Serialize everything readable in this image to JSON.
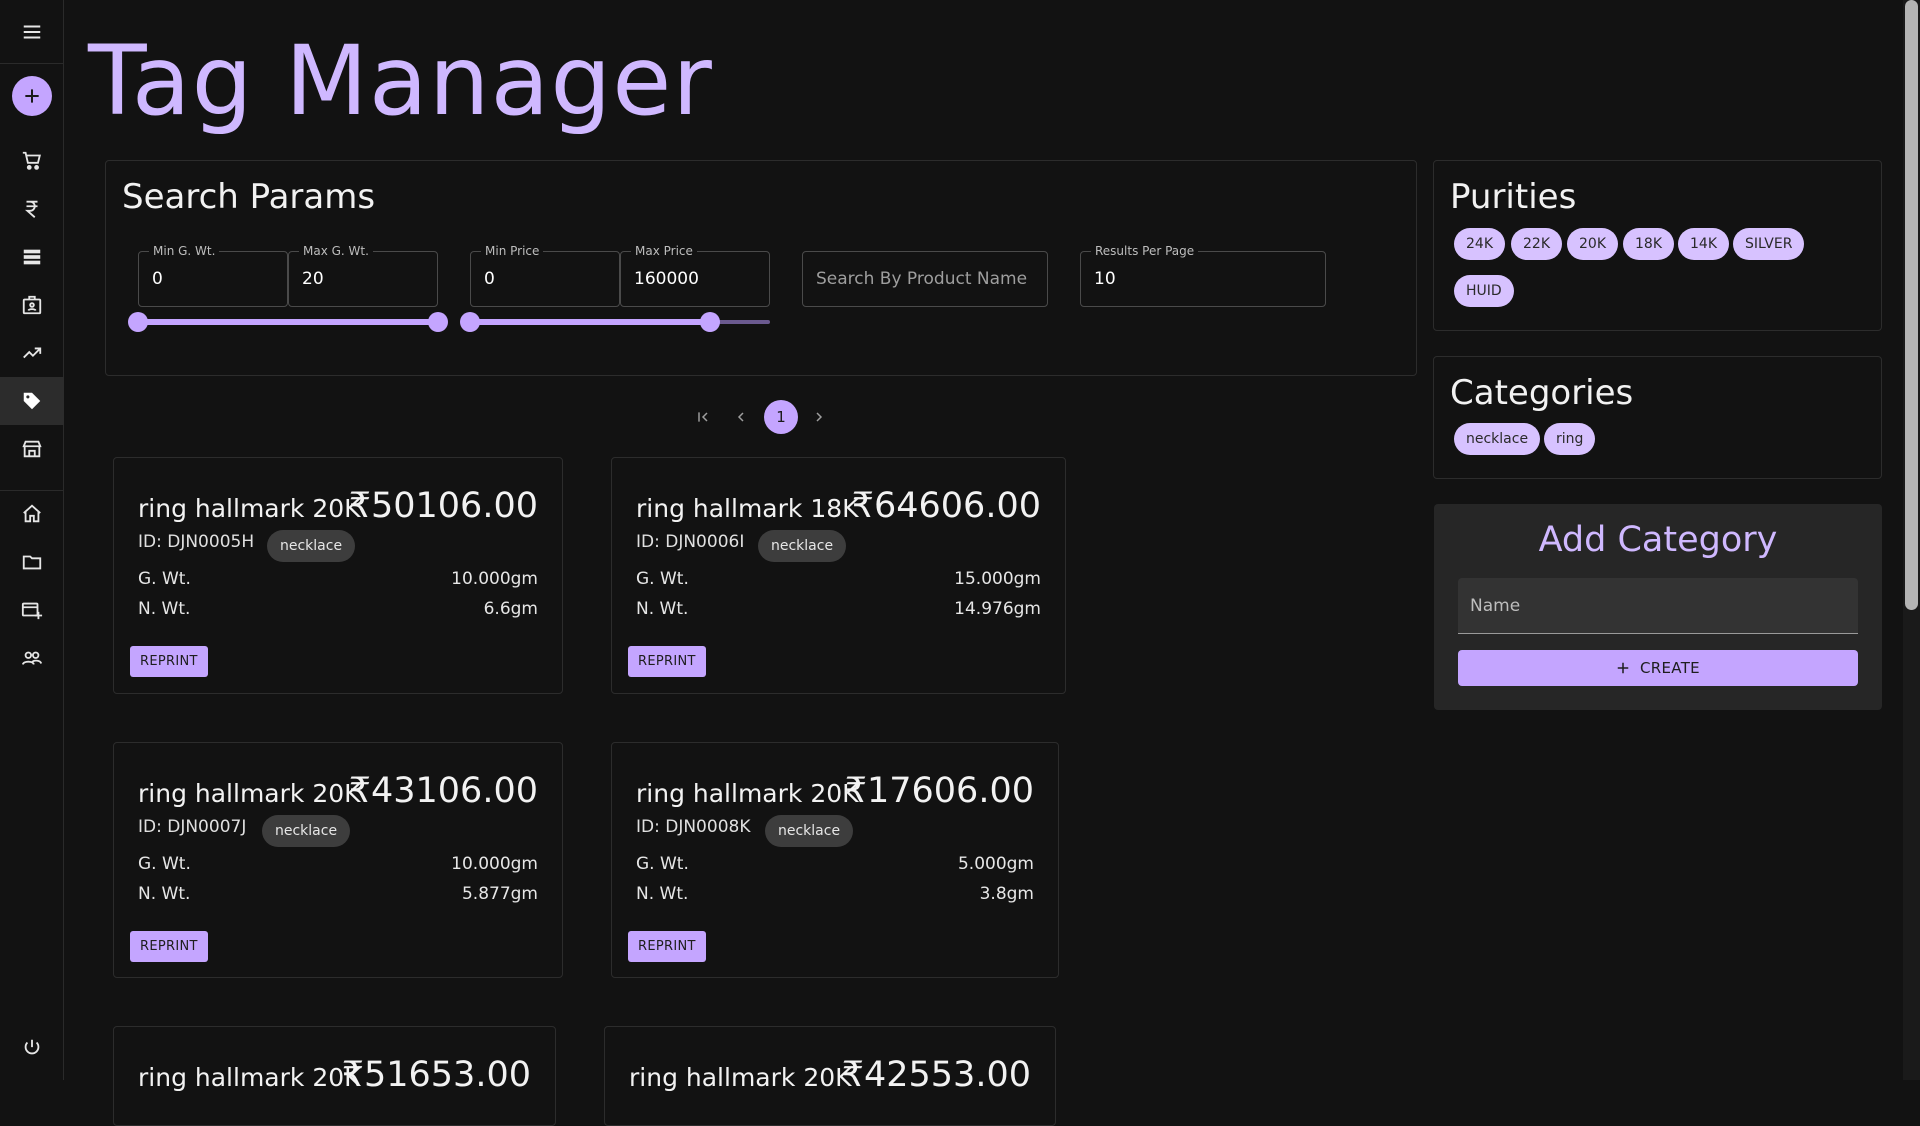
{
  "page": {
    "title": "Tag Manager"
  },
  "sidebar": {
    "menu_icon": "menu-icon",
    "add_icon": "plus-icon",
    "items": [
      {
        "name": "cart",
        "icon": "cart-icon",
        "active": false
      },
      {
        "name": "rupee",
        "icon": "rupee-icon",
        "active": false
      },
      {
        "name": "list",
        "icon": "list-icon",
        "active": false
      },
      {
        "name": "badge",
        "icon": "badge-icon",
        "active": false
      },
      {
        "name": "trending",
        "icon": "trending-icon",
        "active": false
      },
      {
        "name": "tags",
        "icon": "tag-icon",
        "active": true
      },
      {
        "name": "store",
        "icon": "store-icon",
        "active": false
      },
      {
        "name": "home",
        "icon": "home-icon",
        "active": false
      },
      {
        "name": "folder",
        "icon": "folder-icon",
        "active": false
      },
      {
        "name": "add-card",
        "icon": "card-add-icon",
        "active": false
      },
      {
        "name": "users",
        "icon": "users-icon",
        "active": false
      }
    ],
    "logout_icon": "power-icon"
  },
  "search": {
    "title": "Search Params",
    "min_gwt": {
      "label": "Min G. Wt.",
      "value": "0"
    },
    "max_gwt": {
      "label": "Max G. Wt.",
      "value": "20"
    },
    "min_price": {
      "label": "Min Price",
      "value": "0"
    },
    "max_price": {
      "label": "Max Price",
      "value": "160000"
    },
    "product_name": {
      "placeholder": "Search By Product Name",
      "value": ""
    },
    "results_per_page": {
      "label": "Results Per Page",
      "value": "10"
    },
    "weight_slider": {
      "min": 0,
      "max": 20,
      "low": 0,
      "high": 20
    },
    "price_slider": {
      "min": 0,
      "max": 200000,
      "low": 0,
      "high": 160000
    }
  },
  "pagination": {
    "current": "1",
    "first_icon": "first-page-icon",
    "prev_icon": "chevron-left-icon",
    "next_icon": "chevron-right-icon"
  },
  "cards": [
    {
      "name": "ring hallmark 20K",
      "price": "₹50106.00",
      "id": "ID: DJN0005H",
      "category": "necklace",
      "gwt_label": "G. Wt.",
      "gwt": "10.000gm",
      "nwt_label": "N. Wt.",
      "nwt": "6.6gm",
      "button": "REPRINT"
    },
    {
      "name": "ring hallmark 18K",
      "price": "₹64606.00",
      "id": "ID: DJN0006I",
      "category": "necklace",
      "gwt_label": "G. Wt.",
      "gwt": "15.000gm",
      "nwt_label": "N. Wt.",
      "nwt": "14.976gm",
      "button": "REPRINT"
    },
    {
      "name": "ring hallmark 20K",
      "price": "₹43106.00",
      "id": "ID: DJN0007J",
      "category": "necklace",
      "gwt_label": "G. Wt.",
      "gwt": "10.000gm",
      "nwt_label": "N. Wt.",
      "nwt": "5.877gm",
      "button": "REPRINT"
    },
    {
      "name": "ring hallmark 20K",
      "price": "₹17606.00",
      "id": "ID: DJN0008K",
      "category": "necklace",
      "gwt_label": "G. Wt.",
      "gwt": "5.000gm",
      "nwt_label": "N. Wt.",
      "nwt": "3.8gm",
      "button": "REPRINT"
    },
    {
      "name": "ring hallmark 20K",
      "price": "₹51653.00"
    },
    {
      "name": "ring hallmark 20K",
      "price": "₹42553.00"
    }
  ],
  "purities": {
    "title": "Purities",
    "items": [
      "24K",
      "22K",
      "20K",
      "18K",
      "14K",
      "SILVER",
      "HUID"
    ]
  },
  "categories": {
    "title": "Categories",
    "items": [
      "necklace",
      "ring"
    ]
  },
  "add_category": {
    "title": "Add Category",
    "name_placeholder": "Name",
    "create_label": "CREATE",
    "create_icon": "plus-icon"
  },
  "colors": {
    "accent": "#c4a5ff",
    "title": "#cfb8ff",
    "background": "#121212",
    "chip": "#3d3d3d",
    "panel": "#262626"
  }
}
